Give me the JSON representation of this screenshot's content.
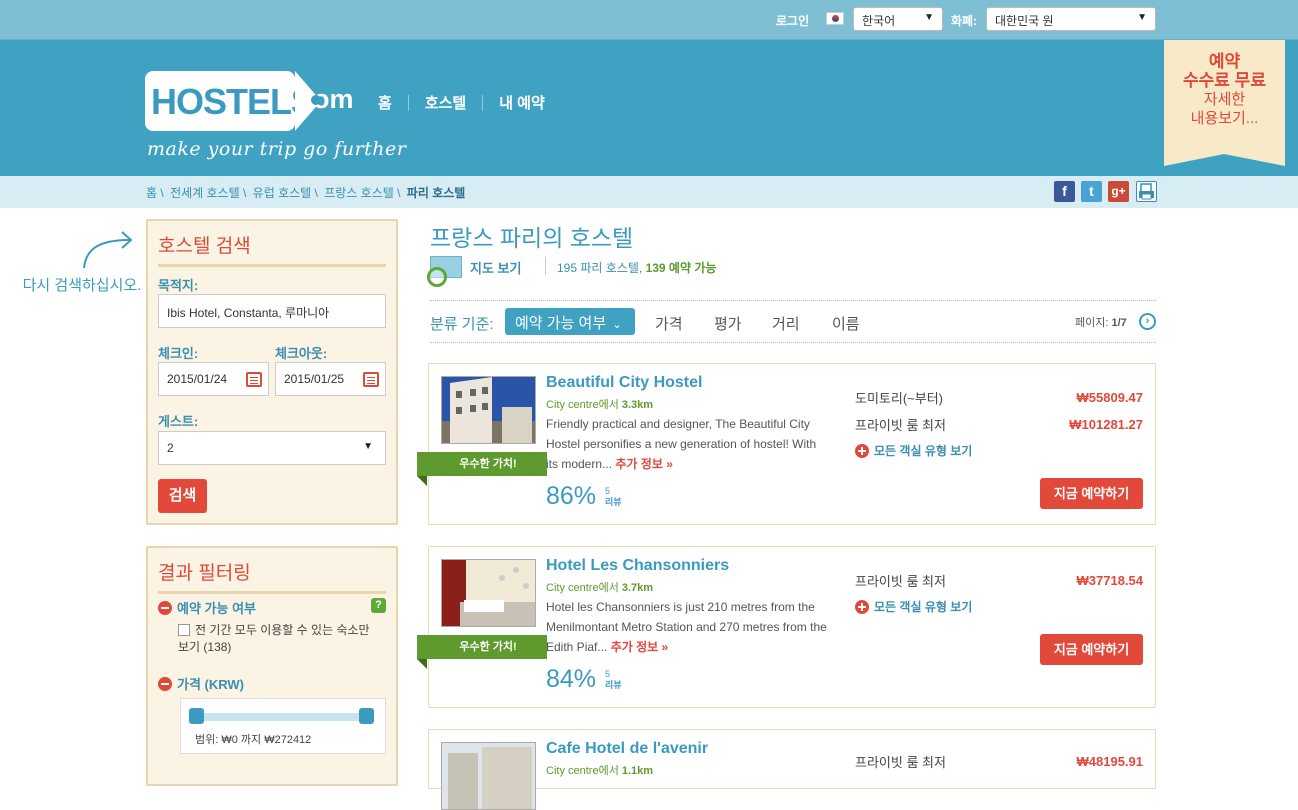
{
  "topbar": {
    "login": "로그인",
    "language": "한국어",
    "currency_label": "화폐:",
    "currency": "대한민국 원"
  },
  "header": {
    "logo_word": "HOSTELS",
    "logo_com": "com",
    "tagline": "make your trip go further",
    "nav": [
      "홈",
      "호스텔",
      "내 예약"
    ],
    "promo_line1": "예약",
    "promo_line2": "수수료 무료",
    "promo_line3": "자세한",
    "promo_line4": "내용보기..."
  },
  "breadcrumb": [
    "홈 \\",
    "전세계 호스텔 \\",
    "유럽 호스텔 \\",
    "프랑스 호스텔 \\",
    "파리 호스텔"
  ],
  "social": {
    "facebook": "f",
    "twitter": "t",
    "gplus": "g+"
  },
  "hint": "다시 검색하십시오.",
  "search": {
    "title": "호스텔 검색",
    "destination_label": "목적지:",
    "destination": "Ibis Hotel, Constanta, 루마니아",
    "checkin_label": "체크인:",
    "checkin": "2015/01/24",
    "checkout_label": "체크아웃:",
    "checkout": "2015/01/25",
    "guests_label": "게스트:",
    "guests": "2",
    "button": "검색"
  },
  "filter": {
    "title": "결과 필터링",
    "availability_title": "예약 가능 여부",
    "availability_check": "전 기간 모두 이용할 수 있는 숙소만 보기 (138)",
    "price_title": "가격 (KRW)",
    "range": "범위: ₩0 까지 ₩272412"
  },
  "main": {
    "title": "프랑스 파리의 호스텔",
    "map_link": "지도 보기",
    "count_prefix": "195 파리 호스텔,",
    "count_bookable": "139 예약 가능",
    "sort_label": "분류 기준:",
    "sort_selected": "예약 가능 여부",
    "sort_options": [
      "가격",
      "평가",
      "거리",
      "이름"
    ],
    "page_label": "페이지:",
    "page_value": "1/7"
  },
  "hostels": [
    {
      "name": "Beautiful City Hostel",
      "dist_prefix": "City centre에서",
      "dist": "3.3km",
      "desc": "Friendly practical and designer, The Beautiful City Hostel personifies a new generation of hostel! With its modern...",
      "more": "추가 정보 »",
      "badge": "우수한 가치!",
      "score": "86%",
      "reviews_n": "5",
      "reviews_label": "리뷰",
      "rooms": [
        {
          "label": "도미토리(~부터)",
          "price": "₩55809.47"
        },
        {
          "label": "프라이빗 룸 최저",
          "price": "₩101281.27"
        }
      ],
      "all_rooms": "모든 객실 유형 보기",
      "book": "지금 예약하기"
    },
    {
      "name": "Hotel Les Chansonniers",
      "dist_prefix": "City centre에서",
      "dist": "3.7km",
      "desc": "Hotel les Chansonniers is just 210 metres from the Menilmontant Metro Station and 270 metres from the Edith Piaf...",
      "more": "추가 정보 »",
      "badge": "우수한 가치!",
      "score": "84%",
      "reviews_n": "5",
      "reviews_label": "리뷰",
      "rooms": [
        {
          "label": "프라이빗 룸 최저",
          "price": "₩37718.54"
        }
      ],
      "all_rooms": "모든 객실 유형 보기",
      "book": "지금 예약하기"
    },
    {
      "name": "Cafe Hotel de l'avenir",
      "dist_prefix": "City centre에서",
      "dist": "1.1km",
      "rooms": [
        {
          "label": "프라이빗 룸 최저",
          "price": "₩48195.91"
        }
      ]
    }
  ]
}
